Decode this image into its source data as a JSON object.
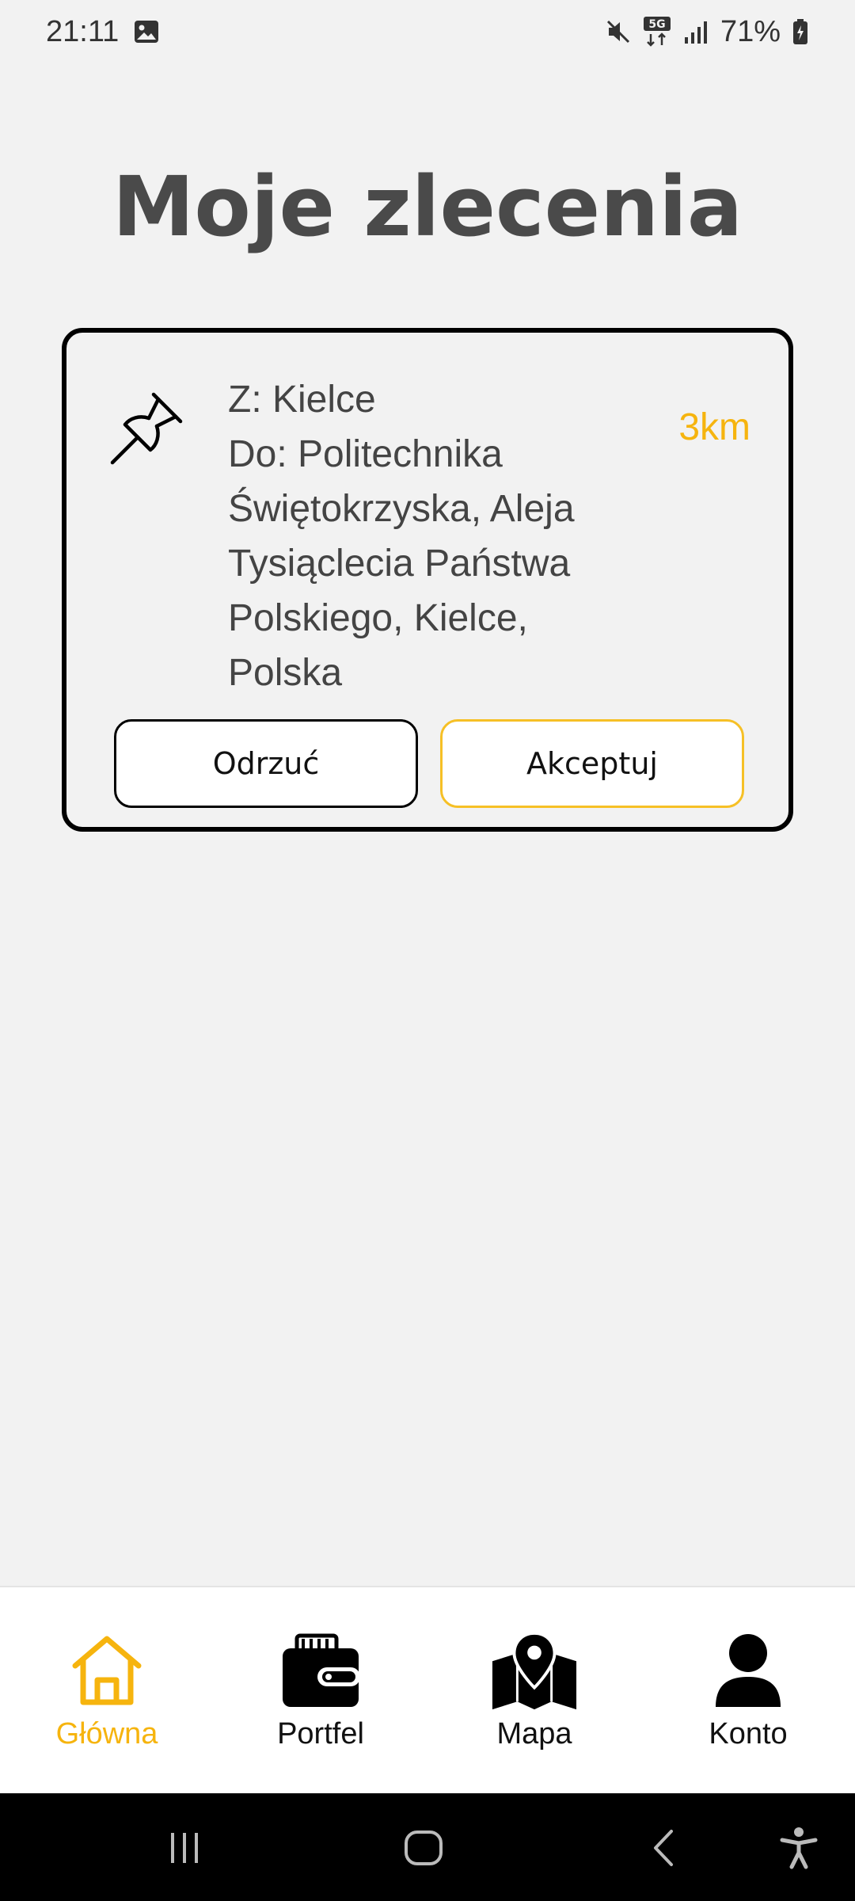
{
  "status_bar": {
    "time": "21:11",
    "battery": "71%",
    "icons": [
      "image-icon",
      "mute-icon",
      "5g-icon",
      "signal-icon",
      "battery-icon"
    ]
  },
  "page": {
    "title": "Moje zlecenia"
  },
  "order": {
    "from": "Z: Kielce",
    "to_lines": [
      "Do: Politechnika",
      "Świętokrzyska, Aleja",
      "Tysiąclecia Państwa",
      "Polskiego, Kielce,",
      "Polska"
    ],
    "distance": "3km",
    "icon": "pin-icon",
    "reject_label": "Odrzuć",
    "accept_label": "Akceptuj"
  },
  "bottom_nav": {
    "items": [
      {
        "label": "Główna",
        "icon": "home-icon",
        "active": true
      },
      {
        "label": "Portfel",
        "icon": "wallet-icon",
        "active": false
      },
      {
        "label": "Mapa",
        "icon": "map-icon",
        "active": false
      },
      {
        "label": "Konto",
        "icon": "account-icon",
        "active": false
      }
    ]
  },
  "colors": {
    "accent": "#f6b40e",
    "background": "#f2f2f2",
    "text": "#444444"
  }
}
